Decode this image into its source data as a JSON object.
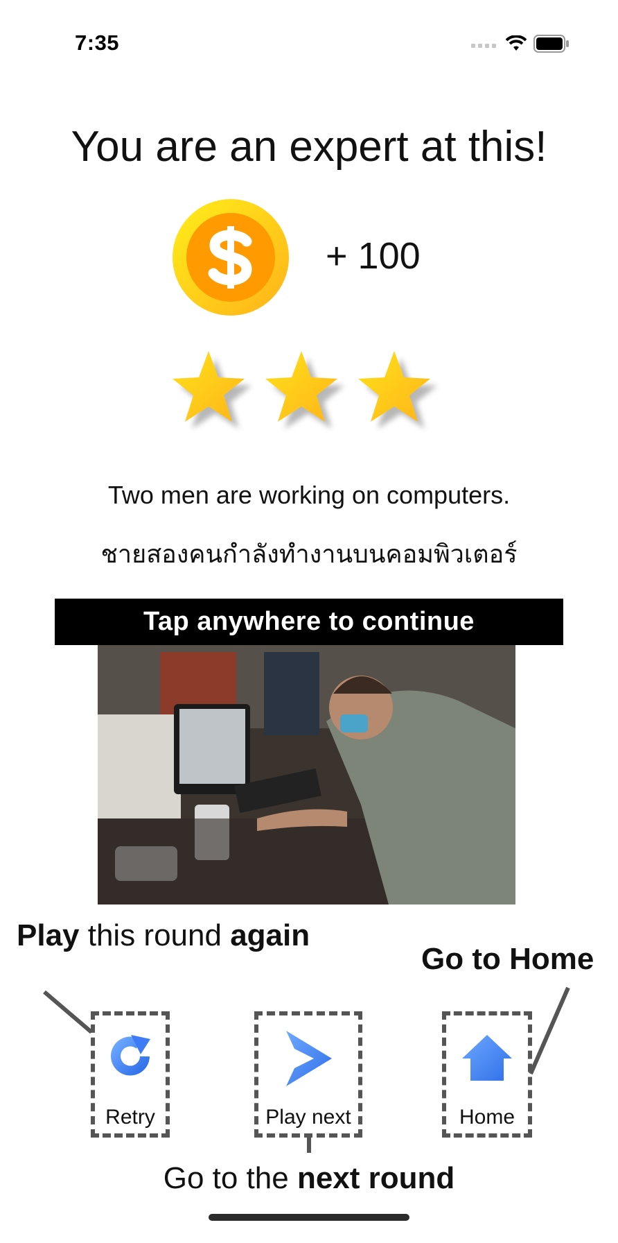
{
  "status_bar": {
    "time": "7:35",
    "icons": [
      "cellular-signal-icon",
      "wifi-icon",
      "battery-icon"
    ]
  },
  "result": {
    "title": "You are an expert at this!",
    "reward": "+ 100",
    "coin_icon": "dollar-coin-icon",
    "stars_earned": 3,
    "stars_total": 3
  },
  "sentence": {
    "english": "Two men are working on computers.",
    "thai": "ชายสองคนกำลังทำงานบนคอมพิวเตอร์"
  },
  "banner": {
    "text": "Tap anywhere to continue"
  },
  "photo": {
    "description_icon": "photo-two-men-working-on-computers"
  },
  "annotations": {
    "retry": {
      "part1": "Play",
      "part2": " this round ",
      "part3": "again"
    },
    "home": {
      "text": "Go to Home"
    },
    "next": {
      "part1": "Go to the ",
      "part2": "next round"
    }
  },
  "controls": {
    "retry_label": "Retry",
    "play_next_label": "Play next",
    "home_label": "Home"
  },
  "colors": {
    "coin_outer": "#FFD21A",
    "coin_inner": "#FF9800",
    "star": "#FFC31A",
    "icon_blue": "#3D7CF5"
  }
}
